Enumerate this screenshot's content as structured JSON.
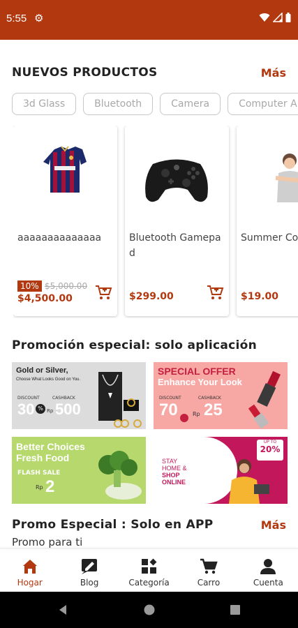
{
  "status_bar": {
    "time": "5:55",
    "bg_color": "#b2380f"
  },
  "new_products": {
    "title": "NUEVOS PRODUCTOS",
    "more_label": "Más",
    "chips": [
      "3d Glass",
      "Bluetooth",
      "Camera",
      "Computer A"
    ],
    "items": [
      {
        "name": "aaaaaaaaaaaaaa",
        "discount": "10%",
        "old_price": "$5,000.00",
        "price": "$4,500.00",
        "image": "jersey-image"
      },
      {
        "name": "Bluetooth Gamepad",
        "price": "$299.00",
        "image": "gamepad-image"
      },
      {
        "name": "Summer Co OK",
        "price": "$19.00",
        "image": "model-image"
      }
    ]
  },
  "promo_app": {
    "title": "Promoción especial: solo aplicación",
    "banners": [
      {
        "title_line1": "Gold or Silver,",
        "title_line2": "Choose What Looks Good on You.",
        "discount_label": "DISCOUNT",
        "discount_value": "30",
        "cashback_label": "CASHBACK",
        "cashback_value": "500",
        "suffix": "%",
        "currency": "Rp"
      },
      {
        "title_line1": "SPECIAL OFFER",
        "title_line2": "Enhance Your Look",
        "discount_label": "DISCOUNT",
        "discount_value": "70",
        "cashback_label": "CASHBACK",
        "cashback_value": "25",
        "currency": "Rp"
      },
      {
        "title_line1": "Better Choices",
        "title_line2": "Fresh Food",
        "flash_label": "FLASH SALE",
        "value": "2",
        "currency": "Rp"
      },
      {
        "title_line1": "STAY",
        "title_line2": "HOME &",
        "title_line3": "SHOP",
        "title_line4": "ONLINE",
        "badge_top": "UP TO",
        "badge_value": "20%"
      }
    ]
  },
  "promo_special": {
    "title": "Promo Especial : Solo en APP",
    "more_label": "Más",
    "subtitle": "Promo para ti"
  },
  "bottom_nav": {
    "items": [
      {
        "label": "Hogar",
        "icon": "home-icon",
        "active": true
      },
      {
        "label": "Blog",
        "icon": "blog-icon",
        "active": false
      },
      {
        "label": "Categoría",
        "icon": "category-icon",
        "active": false
      },
      {
        "label": "Carro",
        "icon": "cart-icon",
        "active": false
      },
      {
        "label": "Cuenta",
        "icon": "account-icon",
        "active": false
      }
    ]
  },
  "colors": {
    "accent": "#b2380f"
  }
}
